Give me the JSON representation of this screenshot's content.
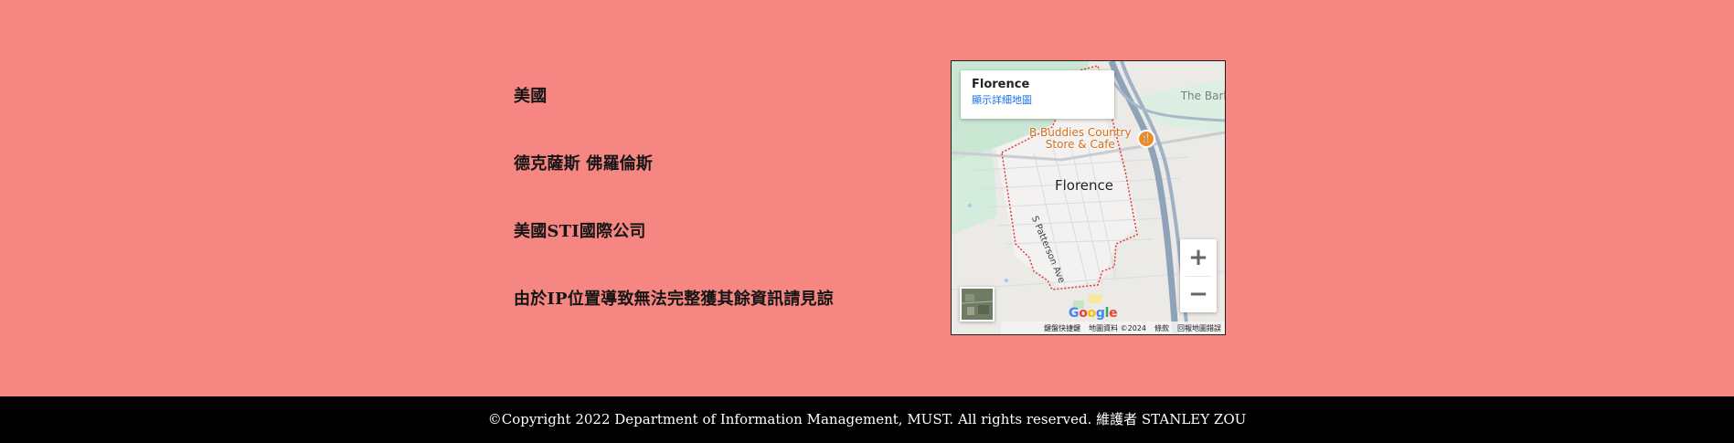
{
  "info": {
    "country": "美國",
    "location": "德克薩斯 佛羅倫斯",
    "organization": "美國STI國際公司",
    "note": "由於IP位置導致無法完整獲其餘資訊請見諒"
  },
  "map": {
    "card_title": "Florence",
    "card_link": "顯示詳細地圖",
    "label_nearby": "The Barb",
    "poi_line1": "B Buddies Country",
    "poi_line2": "Store & Cafe",
    "city_label": "Florence",
    "street_label": "S Patterson Ave",
    "zoom_in": "+",
    "zoom_out": "−",
    "google_logo": "Google",
    "attribution": {
      "shortcuts": "鍵盤快捷鍵",
      "data": "地圖資料 ©2024",
      "terms": "條款",
      "report": "回報地圖錯誤"
    },
    "colors": {
      "land": "#ebeae6",
      "park": "#c9e7d3",
      "highway": "#8ea3b8",
      "boundary": "#e53935",
      "poi": "#f08a24"
    }
  },
  "footer": {
    "copyright": "©Copyright 2022 Department of Information Management, MUST. All rights reserved. 維護者 STANLEY ZOU"
  },
  "colors": {
    "background": "#f68682",
    "footer_bg": "#000000"
  }
}
